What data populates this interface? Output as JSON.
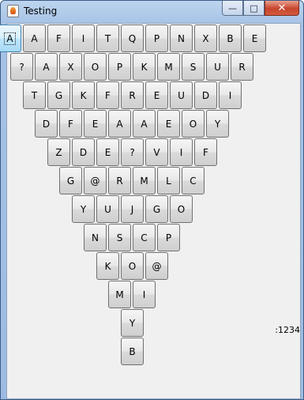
{
  "window": {
    "title": "Testing",
    "minimize_glyph": "—",
    "maximize_glyph": "□",
    "close_glyph": "✕"
  },
  "rows": [
    [
      "A",
      "A",
      "F",
      "I",
      "T",
      "Q",
      "P",
      "N",
      "X",
      "B",
      "E"
    ],
    [
      "?",
      "A",
      "X",
      "O",
      "P",
      "K",
      "M",
      "S",
      "U",
      "R"
    ],
    [
      "T",
      "G",
      "K",
      "F",
      "R",
      "E",
      "U",
      "D",
      "I"
    ],
    [
      "D",
      "F",
      "E",
      "A",
      "A",
      "E",
      "O",
      "Y"
    ],
    [
      "Z",
      "D",
      "E",
      "?",
      "V",
      "I",
      "F"
    ],
    [
      "G",
      "@",
      "R",
      "M",
      "L",
      "C"
    ],
    [
      "Y",
      "U",
      "J",
      "G",
      "O"
    ],
    [
      "N",
      "S",
      "C",
      "P"
    ],
    [
      "K",
      "O",
      "@"
    ],
    [
      "M",
      "I"
    ],
    [
      "Y"
    ],
    [
      "B"
    ]
  ],
  "status_text": ":1234"
}
